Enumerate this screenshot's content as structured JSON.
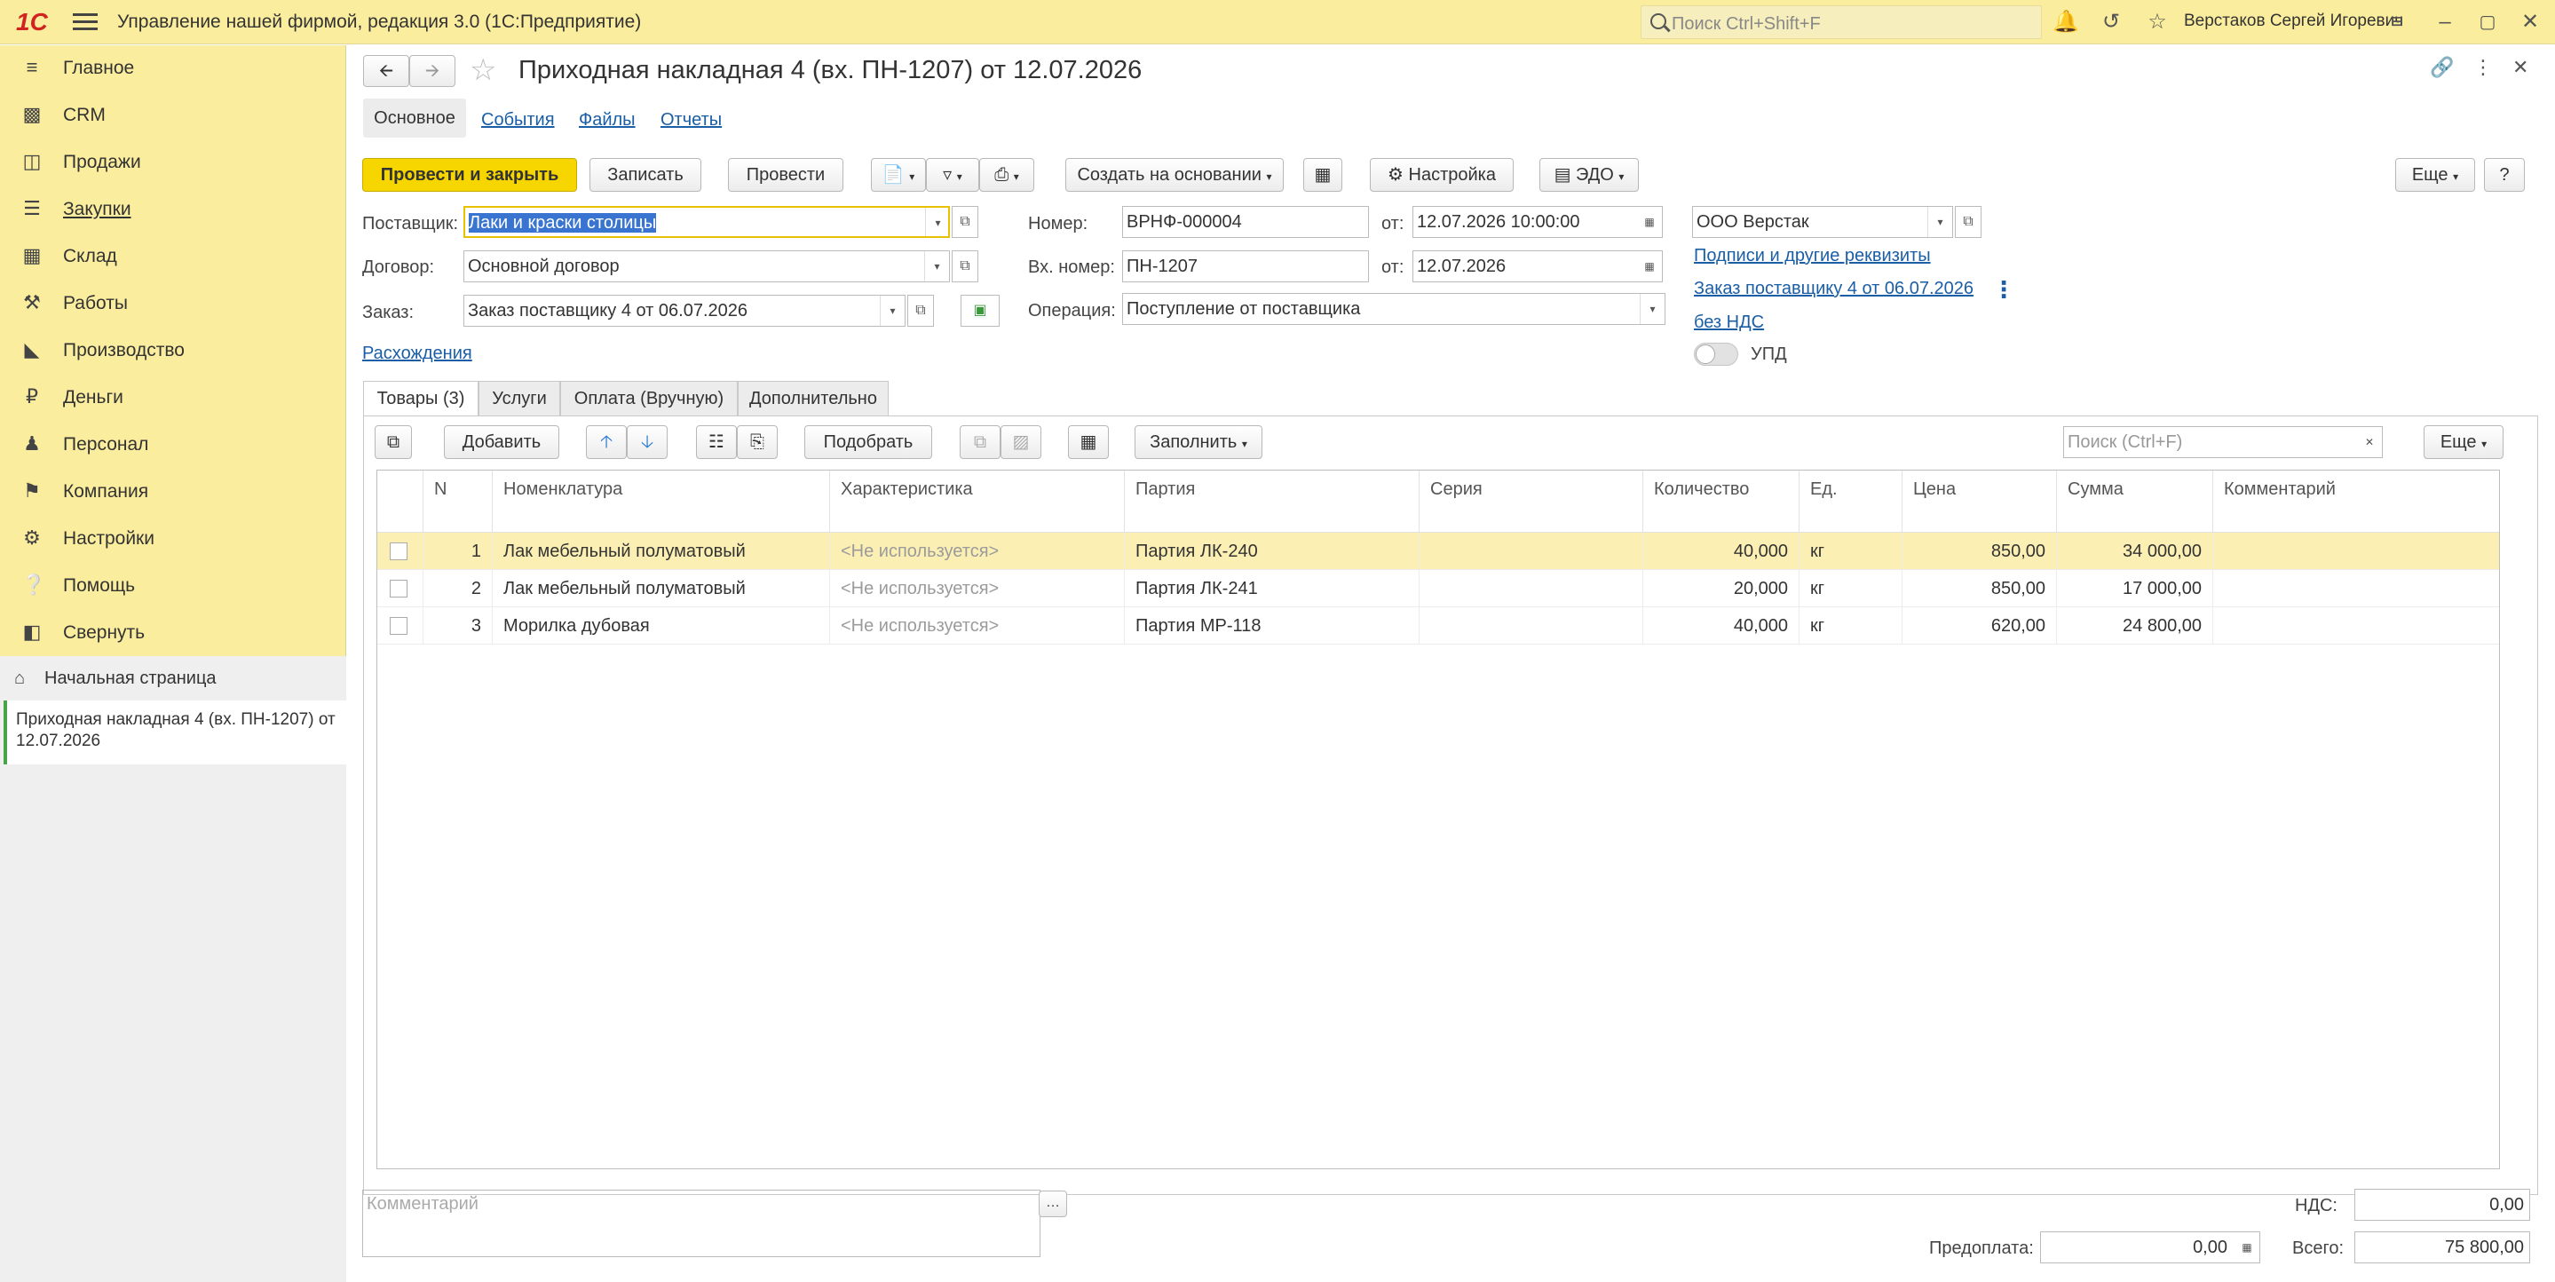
{
  "titlebar": {
    "logo": "1С",
    "app_title": "Управление нашей фирмой, редакция 3.0  (1С:Предприятие)",
    "search_placeholder": "Поиск Ctrl+Shift+F",
    "user": "Верстаков Сергей Игоревич"
  },
  "sidebar": {
    "items": [
      {
        "label": "Главное",
        "icon": "menu-lines-icon"
      },
      {
        "label": "CRM",
        "icon": "crm-icon"
      },
      {
        "label": "Продажи",
        "icon": "basket-icon"
      },
      {
        "label": "Закупки",
        "icon": "purchases-icon"
      },
      {
        "label": "Склад",
        "icon": "warehouse-icon"
      },
      {
        "label": "Работы",
        "icon": "tools-icon"
      },
      {
        "label": "Производство",
        "icon": "factory-icon"
      },
      {
        "label": "Деньги",
        "icon": "money-icon"
      },
      {
        "label": "Персонал",
        "icon": "people-icon"
      },
      {
        "label": "Компания",
        "icon": "flag-icon"
      },
      {
        "label": "Настройки",
        "icon": "gear-icon"
      },
      {
        "label": "Помощь",
        "icon": "help-icon"
      },
      {
        "label": "Свернуть",
        "icon": "collapse-icon"
      }
    ],
    "home": "Начальная страница",
    "open_document": "Приходная накладная 4 (вх. ПН-1207) от 12.07.2026"
  },
  "header": {
    "title": "Приходная накладная 4 (вх. ПН-1207) от 12.07.2026",
    "nav_tabs": [
      "Основное",
      "События",
      "Файлы",
      "Отчеты"
    ]
  },
  "toolbar": {
    "post_close": "Провести и закрыть",
    "save": "Записать",
    "post": "Провести",
    "create_based": "Создать на основании",
    "settings": "Настройка",
    "edo": "ЭДО",
    "more": "Еще",
    "help": "?"
  },
  "form": {
    "supplier_label": "Поставщик:",
    "supplier_value": "Лаки и краски столицы",
    "contract_label": "Договор:",
    "contract_value": "Основной договор",
    "order_label": "Заказ:",
    "order_value": "Заказ поставщику 4 от 06.07.2026",
    "discrepancies_link": "Расхождения",
    "number_label": "Номер:",
    "number_value": "ВРНФ-000004",
    "from_label": "от:",
    "date_value": "12.07.2026 10:00:00",
    "in_number_label": "Вх. номер:",
    "in_number_value": "ПН-1207",
    "in_date_value": "12.07.2026",
    "operation_label": "Операция:",
    "operation_value": "Поступление от поставщика",
    "company_value": "ООО Верстак",
    "signatures_link": "Подписи и другие реквизиты",
    "order_link": "Заказ поставщику 4 от 06.07.2026",
    "vat_link": "без НДС",
    "upd_label": "УПД"
  },
  "tabs": {
    "items": [
      "Товары (3)",
      "Услуги",
      "Оплата (Вручную)",
      "Дополнительно"
    ]
  },
  "table_toolbar": {
    "add": "Добавить",
    "pick": "Подобрать",
    "fill": "Заполнить",
    "search_placeholder": "Поиск (Ctrl+F)",
    "more": "Еще"
  },
  "table": {
    "columns": [
      "N",
      "Номенклатура",
      "Характеристика",
      "Партия",
      "Серия",
      "Количество",
      "Ед.",
      "Цена",
      "Сумма",
      "Комментарий"
    ],
    "rows": [
      {
        "n": "1",
        "item": "Лак мебельный полуматовый",
        "char": "<Не используется>",
        "batch": "Партия ЛК-240",
        "series": "",
        "qty": "40,000",
        "unit": "кг",
        "price": "850,00",
        "sum": "34 000,00",
        "comment": ""
      },
      {
        "n": "2",
        "item": "Лак мебельный полуматовый",
        "char": "<Не используется>",
        "batch": "Партия ЛК-241",
        "series": "",
        "qty": "20,000",
        "unit": "кг",
        "price": "850,00",
        "sum": "17 000,00",
        "comment": ""
      },
      {
        "n": "3",
        "item": "Морилка дубовая",
        "char": "<Не используется>",
        "batch": "Партия МР-118",
        "series": "",
        "qty": "40,000",
        "unit": "кг",
        "price": "620,00",
        "sum": "24 800,00",
        "comment": ""
      }
    ]
  },
  "footer": {
    "comment_placeholder": "Комментарий",
    "vat_label": "НДС:",
    "vat_value": "0,00",
    "prepay_label": "Предоплата:",
    "prepay_value": "0,00",
    "total_label": "Всего:",
    "total_value": "75 800,00"
  }
}
